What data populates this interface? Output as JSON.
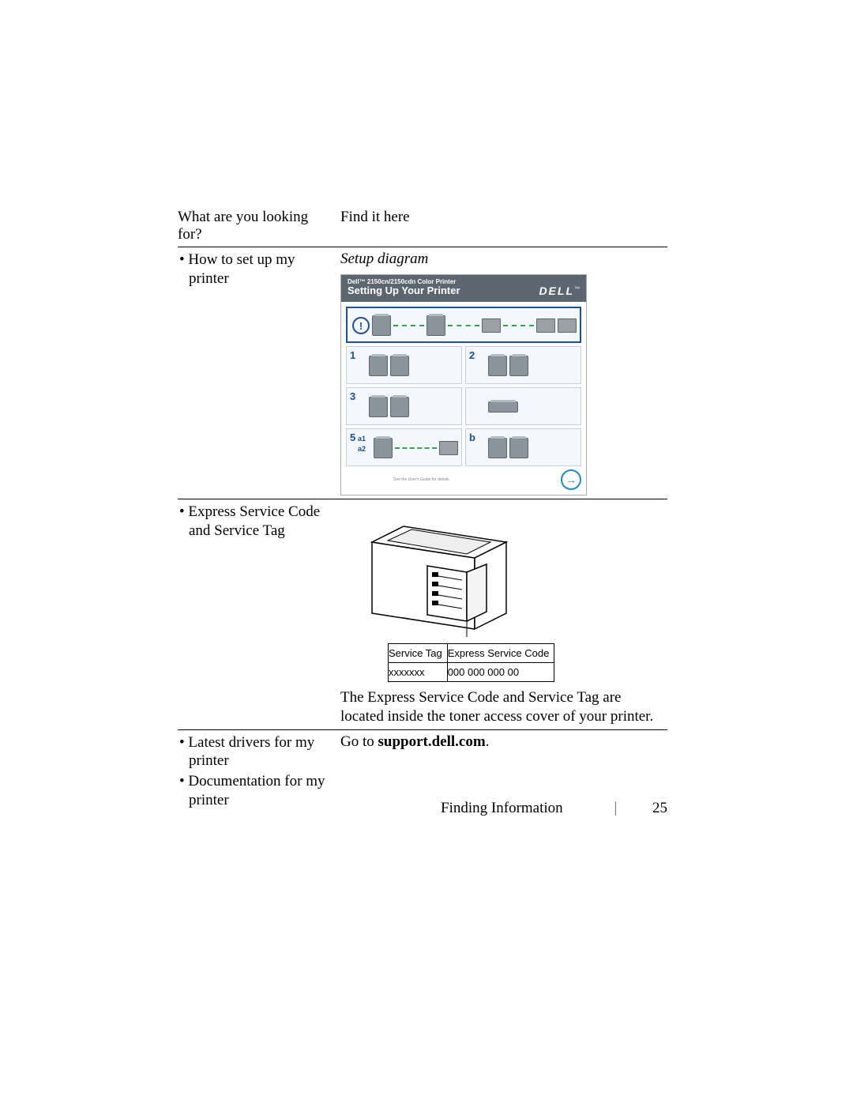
{
  "headers": {
    "left": "What are you looking for?",
    "right": "Find it here"
  },
  "rows": [
    {
      "left_items": [
        "How to set up my printer"
      ],
      "right_title": "Setup diagram",
      "setup": {
        "product": "Dell™ 2150cn/2150cdn Color Printer",
        "title": "Setting Up Your Printer",
        "brand": "DELL",
        "tm": "™",
        "steps": {
          "s1": "1",
          "s2": "2",
          "s3": "3",
          "s5": "5",
          "a1": "a1",
          "a2": "a2",
          "b": "b"
        },
        "alert_glyph": "!",
        "arrow_glyph": "→",
        "footnote": "See the User's Guide for details."
      }
    },
    {
      "left_items": [
        "Express Service Code and Service Tag"
      ],
      "tag_table": {
        "h1": "Service Tag",
        "h2": "Express Service Code",
        "v1": "xxxxxxx",
        "v2": "000 000 000 00"
      },
      "explain": "The Express Service Code and Service Tag are located inside the toner access cover of your printer."
    },
    {
      "left_items": [
        "Latest drivers for my printer",
        "Documentation for my printer"
      ],
      "right_prefix": "Go to ",
      "right_link": "support.dell.com",
      "right_suffix": "."
    }
  ],
  "footer": {
    "section": "Finding Information",
    "sep": "|",
    "page": "25"
  }
}
